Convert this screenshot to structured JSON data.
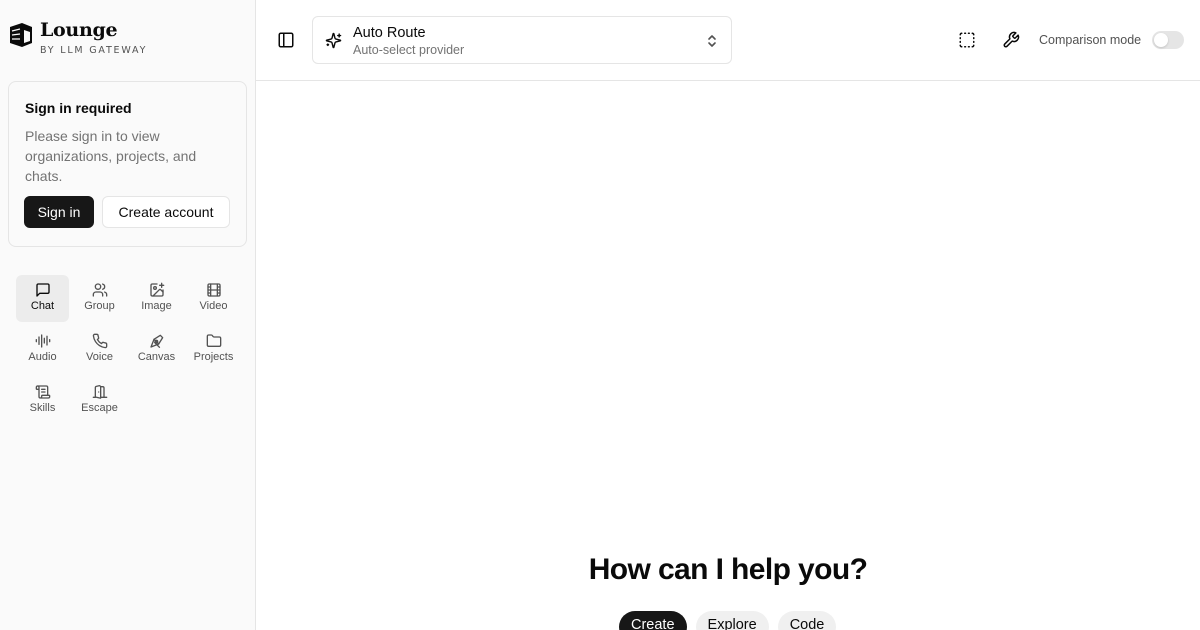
{
  "brand": {
    "title": "Lounge",
    "subtitle": "BY LLM GATEWAY"
  },
  "signin": {
    "title": "Sign in required",
    "description": "Please sign in to view organizations, projects, and chats.",
    "signin_label": "Sign in",
    "create_label": "Create account"
  },
  "nav": {
    "items": [
      {
        "label": "Chat",
        "icon": "message-square-icon",
        "active": true
      },
      {
        "label": "Group",
        "icon": "users-icon",
        "active": false
      },
      {
        "label": "Image",
        "icon": "image-plus-icon",
        "active": false
      },
      {
        "label": "Video",
        "icon": "film-icon",
        "active": false
      },
      {
        "label": "Audio",
        "icon": "audio-lines-icon",
        "active": false
      },
      {
        "label": "Voice",
        "icon": "phone-icon",
        "active": false
      },
      {
        "label": "Canvas",
        "icon": "pen-tool-icon",
        "active": false
      },
      {
        "label": "Projects",
        "icon": "folder-icon",
        "active": false
      },
      {
        "label": "Skills",
        "icon": "scroll-icon",
        "active": false
      },
      {
        "label": "Escape",
        "icon": "door-icon",
        "active": false
      }
    ]
  },
  "header": {
    "model_name": "Auto Route",
    "model_sub": "Auto-select provider",
    "comparison_label": "Comparison mode",
    "comparison_enabled": false
  },
  "main": {
    "heading": "How can I help you?",
    "chips": [
      {
        "label": "Create",
        "active": true
      },
      {
        "label": "Explore",
        "active": false
      },
      {
        "label": "Code",
        "active": false
      }
    ]
  },
  "colors": {
    "primary": "#171717",
    "border": "#e5e5e5",
    "sidebar_bg": "#fafafa",
    "muted_text": "#737373"
  }
}
